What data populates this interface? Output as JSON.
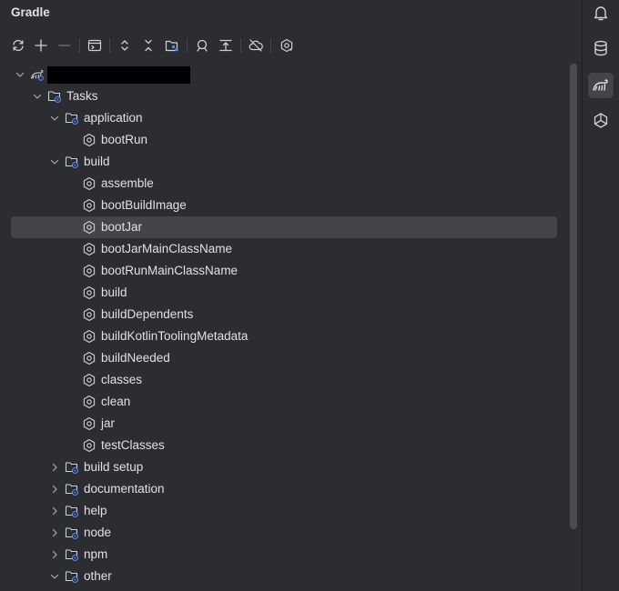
{
  "panel": {
    "title": "Gradle"
  },
  "toolbar": {
    "buttons": [
      "reload-icon",
      "add-icon",
      "remove-icon",
      "run-task-icon",
      "expand-all-icon",
      "collapse-all-icon",
      "group-modules-icon",
      "analyze-icon",
      "link-icon",
      "offline-mode-icon",
      "settings-icon"
    ]
  },
  "tree": {
    "root": {
      "label": ""
    },
    "tasks": {
      "label": "Tasks"
    },
    "application": {
      "label": "application"
    },
    "bootRun": {
      "label": "bootRun"
    },
    "build": {
      "label": "build"
    },
    "build_tasks": [
      "assemble",
      "bootBuildImage",
      "bootJar",
      "bootJarMainClassName",
      "bootRunMainClassName",
      "build",
      "buildDependents",
      "buildKotlinToolingMetadata",
      "buildNeeded",
      "classes",
      "clean",
      "jar",
      "testClasses"
    ],
    "selected": "bootJar",
    "groups": [
      "build setup",
      "documentation",
      "help",
      "node",
      "npm",
      "other"
    ]
  },
  "rail": {
    "items": [
      "notifications-icon",
      "database-icon",
      "gradle-icon",
      "ai-assistant-icon"
    ],
    "active": "gradle-icon"
  },
  "colors": {
    "background": "#2b2d30",
    "selection": "#43454a",
    "text": "#dfe1e5",
    "icon": "#ced0d6",
    "accent": "#548af7"
  }
}
